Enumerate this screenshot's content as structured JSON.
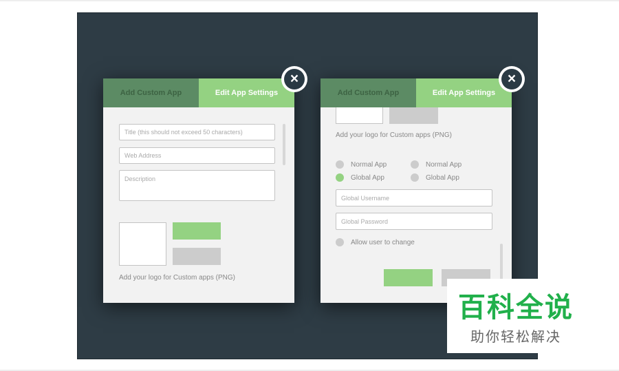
{
  "left_panel": {
    "tabs": {
      "add": "Add Custom App",
      "edit": "Edit App Settings"
    },
    "title_placeholder": "Title (this should not exceed 50 characters)",
    "web_placeholder": "Web Address",
    "desc_placeholder": "Description",
    "logo_caption": "Add your logo for Custom apps (PNG)"
  },
  "right_panel": {
    "tabs": {
      "add": "Add Custom App",
      "edit": "Edit App Settings"
    },
    "logo_caption": "Add your logo for Custom apps (PNG)",
    "radios": {
      "normal_1": "Normal App",
      "normal_2": "Normal App",
      "global_1": "Global App",
      "global_2": "Global App"
    },
    "username_placeholder": "Global Username",
    "password_placeholder": "Global Password",
    "allow_change": "Allow user to change"
  },
  "close_icon": "close-icon",
  "colors": {
    "accent": "#94d282",
    "tab_dark": "#5c8b64",
    "backdrop": "#2e3c45"
  },
  "watermark": {
    "title": "百科全说",
    "subtitle": "助你轻松解决"
  }
}
